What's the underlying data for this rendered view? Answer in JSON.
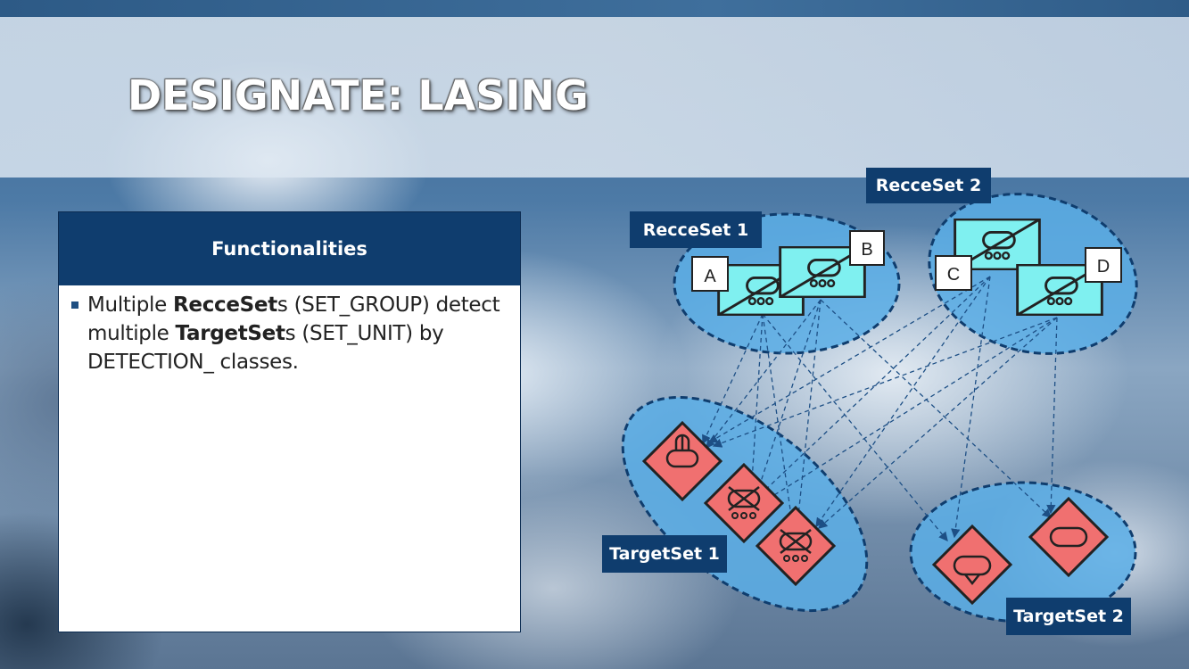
{
  "title": "DESIGNATE: LASING",
  "panel": {
    "header": "Functionalities",
    "bullet": {
      "t1": "Multiple ",
      "b1": "RecceSet",
      "t2": "s (SET_GROUP) detect multiple ",
      "b2": "TargetSet",
      "t3": "s (SET_UNIT) by DETECTION_ classes."
    }
  },
  "diagram": {
    "recce_sets": [
      {
        "label": "RecceSet 1",
        "units": [
          "A",
          "B"
        ]
      },
      {
        "label": "RecceSet 2",
        "units": [
          "C",
          "D"
        ]
      }
    ],
    "target_sets": [
      {
        "label": "TargetSet 1"
      },
      {
        "label": "TargetSet 2"
      }
    ]
  },
  "colors": {
    "set_fill": "#5aaee6",
    "set_border": "#0f3d6e",
    "recce_fill": "#7ff0f0",
    "target_fill": "#f07070",
    "label_bg": "#0f3d6e"
  }
}
